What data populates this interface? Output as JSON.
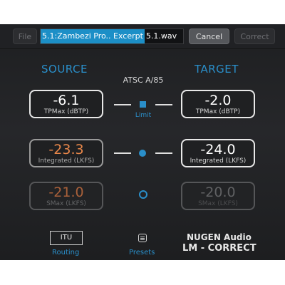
{
  "toolbar": {
    "file_label": "File",
    "filename_selected": "5.1:Zambezi Pro..  Excerpt",
    "filename_rest": "5.1.wav",
    "cancel_label": "Cancel",
    "correct_label": "Correct"
  },
  "headers": {
    "source": "SOURCE",
    "target": "TARGET",
    "standard": "ATSC A/85"
  },
  "rows": [
    {
      "source_value": "-6.1",
      "source_label": "TPMax (dBTP)",
      "target_value": "-2.0",
      "target_label": "TPMax (dBTP)",
      "link_label": "Limit"
    },
    {
      "source_value": "-23.3",
      "source_label": "Integrated (LKFS)",
      "target_value": "-24.0",
      "target_label": "Integrated (LKFS)"
    },
    {
      "source_value": "-21.0",
      "source_label": "SMax (LKFS)",
      "target_value": "-20.0",
      "target_label": "SMax (LKFS)"
    }
  ],
  "footer": {
    "itu_label": "ITU",
    "routing_label": "Routing",
    "presets_label": "Presets",
    "brand_line1": "NUGEN Audio",
    "brand_line2": "LM - CORRECT"
  },
  "colors": {
    "accent": "#2a8fca",
    "source_value": "#e9874a",
    "panel": "#232426"
  }
}
